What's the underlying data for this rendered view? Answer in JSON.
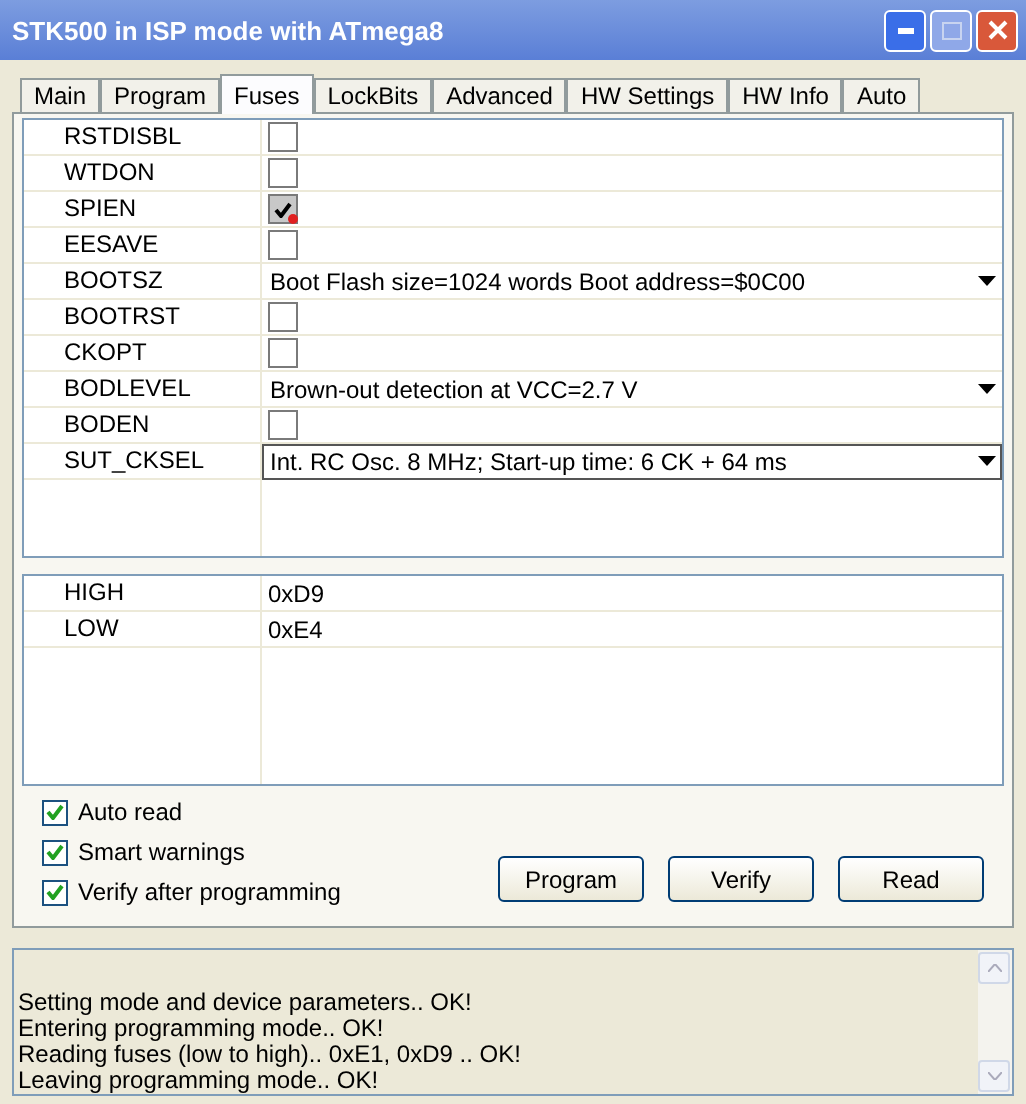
{
  "window": {
    "title": "STK500 in ISP mode with ATmega8"
  },
  "tabs": [
    {
      "label": "Main",
      "selected": false
    },
    {
      "label": "Program",
      "selected": false
    },
    {
      "label": "Fuses",
      "selected": true
    },
    {
      "label": "LockBits",
      "selected": false
    },
    {
      "label": "Advanced",
      "selected": false
    },
    {
      "label": "HW Settings",
      "selected": false
    },
    {
      "label": "HW Info",
      "selected": false
    },
    {
      "label": "Auto",
      "selected": false
    }
  ],
  "fuses": [
    {
      "name": "RSTDISBL",
      "kind": "checkbox",
      "checked": false,
      "disabled": false
    },
    {
      "name": "WTDON",
      "kind": "checkbox",
      "checked": false,
      "disabled": false
    },
    {
      "name": "SPIEN",
      "kind": "checkbox",
      "checked": true,
      "disabled": true
    },
    {
      "name": "EESAVE",
      "kind": "checkbox",
      "checked": false,
      "disabled": false
    },
    {
      "name": "BOOTSZ",
      "kind": "select",
      "value": "Boot Flash size=1024 words Boot address=$0C00",
      "focused": false
    },
    {
      "name": "BOOTRST",
      "kind": "checkbox",
      "checked": false,
      "disabled": false
    },
    {
      "name": "CKOPT",
      "kind": "checkbox",
      "checked": false,
      "disabled": false
    },
    {
      "name": "BODLEVEL",
      "kind": "select",
      "value": "Brown-out detection at VCC=2.7 V",
      "focused": false
    },
    {
      "name": "BODEN",
      "kind": "checkbox",
      "checked": false,
      "disabled": false
    },
    {
      "name": "SUT_CKSEL",
      "kind": "select",
      "value": "Int. RC Osc. 8 MHz; Start-up time: 6 CK + 64 ms",
      "focused": true
    }
  ],
  "fuse_values": [
    {
      "name": "HIGH",
      "value": "0xD9"
    },
    {
      "name": "LOW",
      "value": "0xE4"
    }
  ],
  "options": [
    {
      "label": "Auto read",
      "checked": true
    },
    {
      "label": "Smart warnings",
      "checked": true
    },
    {
      "label": "Verify after programming",
      "checked": true
    }
  ],
  "buttons": [
    "Program",
    "Verify",
    "Read"
  ],
  "log": [
    "Setting mode and device parameters.. OK!",
    "Entering programming mode.. OK!",
    "Reading fuses (low to high).. 0xE1, 0xD9 .. OK!",
    "Leaving programming mode.. OK!"
  ]
}
